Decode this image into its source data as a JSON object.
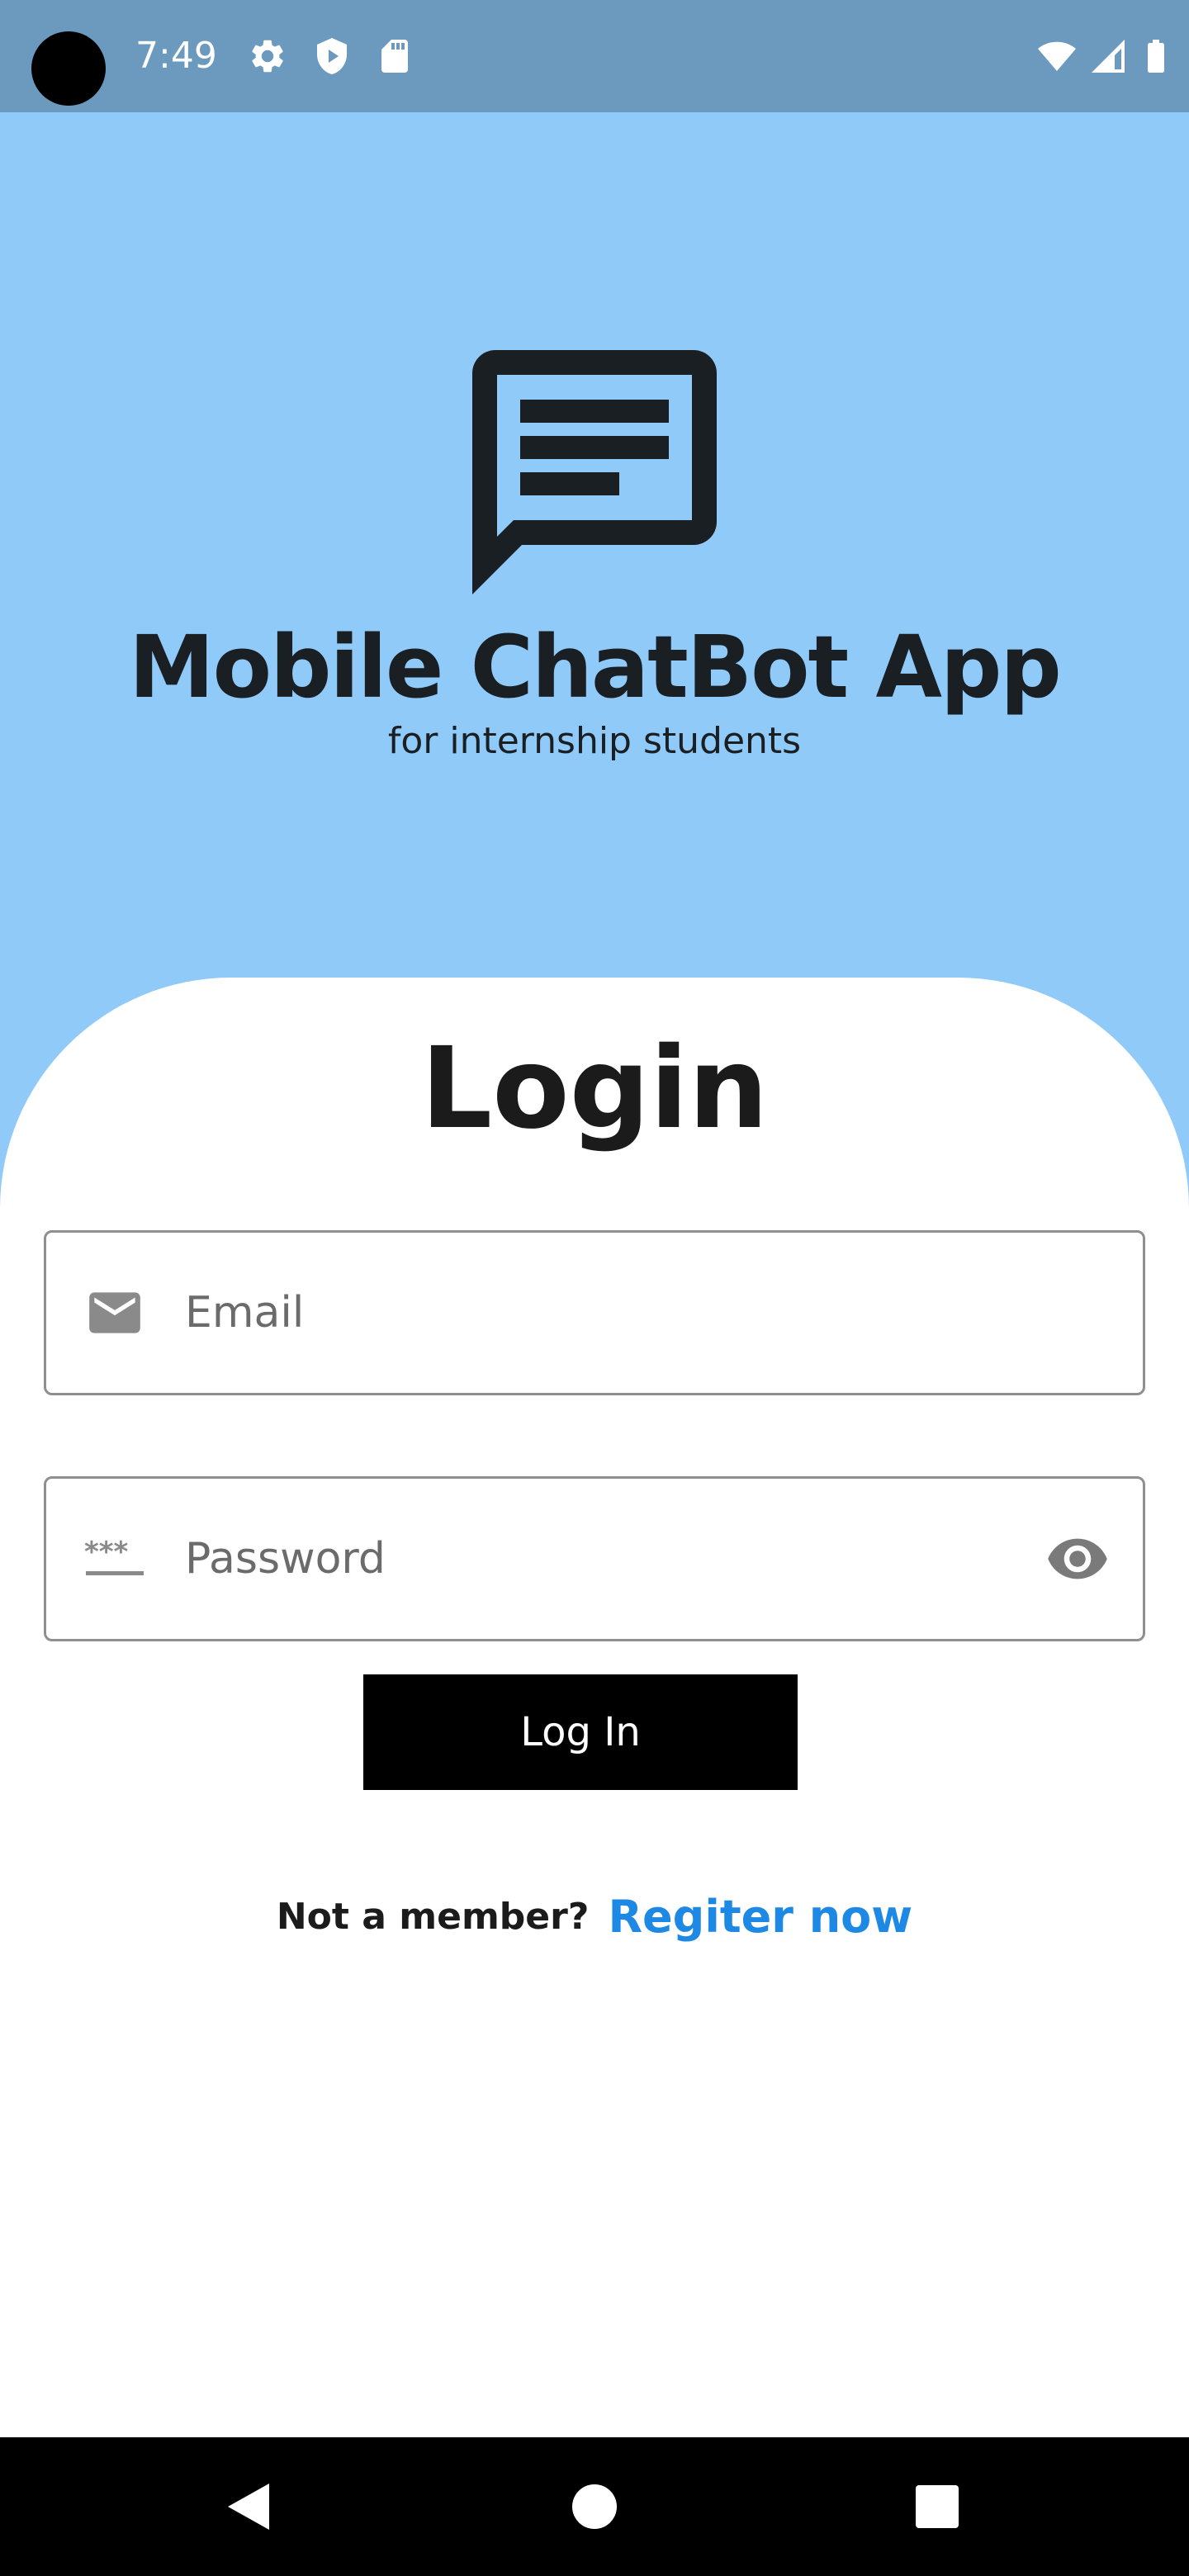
{
  "status_bar": {
    "time": "7:49",
    "left_icons": [
      "settings-icon",
      "shield-icon",
      "sd-card-icon"
    ],
    "right_icons": [
      "wifi-icon",
      "cell-signal-icon",
      "battery-icon"
    ]
  },
  "hero": {
    "logo_icon": "chat-message-icon",
    "title": "Mobile ChatBot App",
    "subtitle": "for internship students",
    "background_color": "#90caf9"
  },
  "login": {
    "heading": "Login",
    "email": {
      "icon": "mail-icon",
      "placeholder": "Email",
      "value": ""
    },
    "password": {
      "icon": "password-icon",
      "placeholder": "Password",
      "value": "",
      "toggle_icon": "eye-icon"
    },
    "submit_label": "Log In",
    "register_prompt": "Not a member?",
    "register_link": "Regiter now",
    "accent_color": "#1e88e5"
  },
  "nav_bar": {
    "buttons": [
      "back-icon",
      "home-icon",
      "recents-icon"
    ]
  }
}
